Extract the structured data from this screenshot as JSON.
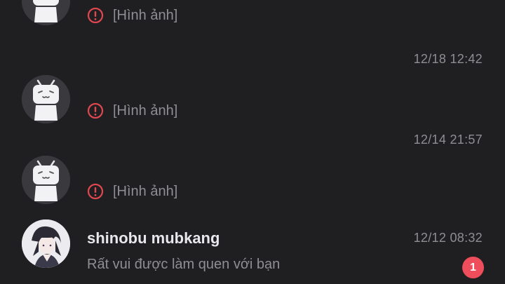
{
  "conversations": [
    {
      "time": "",
      "preview": "[Hình ảnh]",
      "warn_icon": "exclamation-circle-icon",
      "avatar": "bilibili-tv-mascot"
    },
    {
      "time": "12/18 12:42",
      "preview": "[Hình ảnh]",
      "warn_icon": "exclamation-circle-icon",
      "avatar": "bilibili-tv-mascot"
    },
    {
      "time": "12/14 21:57",
      "preview": "[Hình ảnh]",
      "warn_icon": "exclamation-circle-icon",
      "avatar": "bilibili-tv-mascot"
    },
    {
      "name": "shinobu mubkang",
      "time": "12/12 08:32",
      "preview": "Rất vui được làm quen với bạn",
      "unread_count": "1",
      "avatar": "user-photo"
    }
  ],
  "colors": {
    "background": "#1f1e21",
    "secondary_text": "#8f8e93",
    "primary_text": "#e8e7ec",
    "warning": "#e0484f",
    "badge": "#ee4d5b"
  }
}
